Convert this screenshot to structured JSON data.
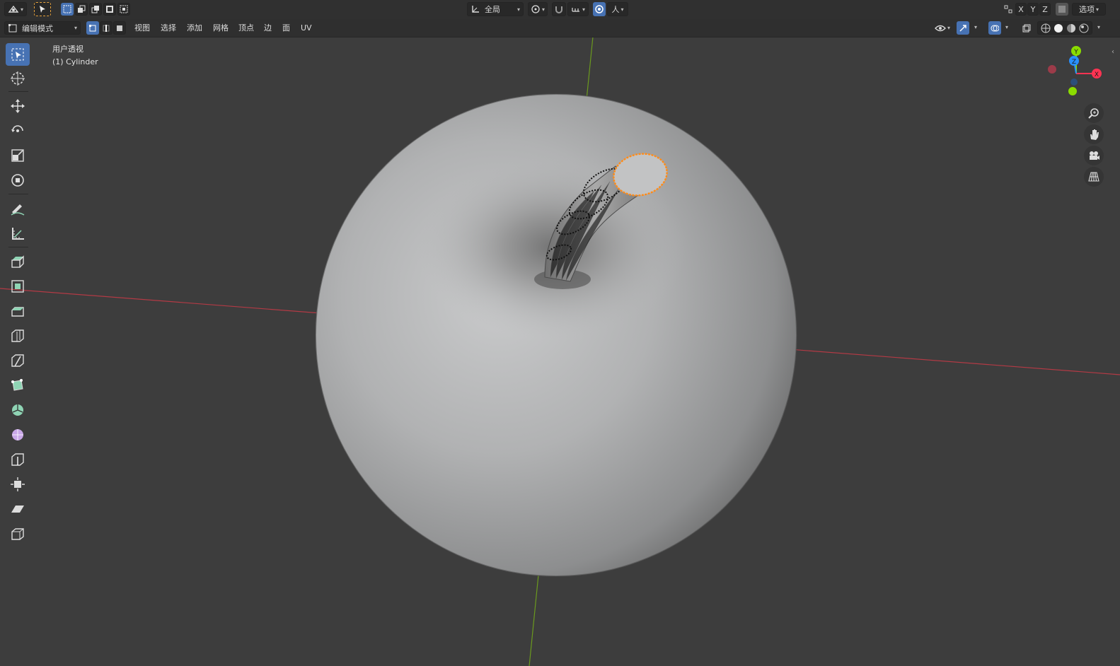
{
  "header": {
    "editor_type_icon": "3d-viewport-icon",
    "orientation_label": "全局",
    "options_label": "选项",
    "axis_x": "X",
    "axis_y": "Y",
    "axis_z": "Z",
    "pivot_label": "人"
  },
  "mode_bar": {
    "mode_label": "编辑模式",
    "menus": [
      "视图",
      "选择",
      "添加",
      "网格",
      "顶点",
      "边",
      "面",
      "UV"
    ]
  },
  "viewport": {
    "view_name": "用户透视",
    "object_name": "(1) Cylinder"
  },
  "gizmo": {
    "x_label": "X",
    "y_label": "Y",
    "z_label": "Z",
    "x_color": "#ff3352",
    "y_color": "#8bdc00",
    "z_color": "#2890ff"
  },
  "colors": {
    "accent": "#4772b3",
    "selection": "#ff8c1a",
    "background": "#3d3d3d"
  },
  "tools": [
    "select-box-icon",
    "cursor-icon",
    "move-icon",
    "rotate-icon",
    "scale-icon",
    "transform-icon",
    "annotate-icon",
    "measure-icon",
    "extrude-icon",
    "inset-icon",
    "bevel-icon",
    "loop-cut-icon",
    "knife-icon",
    "poly-build-icon",
    "spin-icon",
    "smooth-icon",
    "edge-slide-icon",
    "shrink-fatten-icon",
    "shear-icon",
    "rip-icon"
  ]
}
